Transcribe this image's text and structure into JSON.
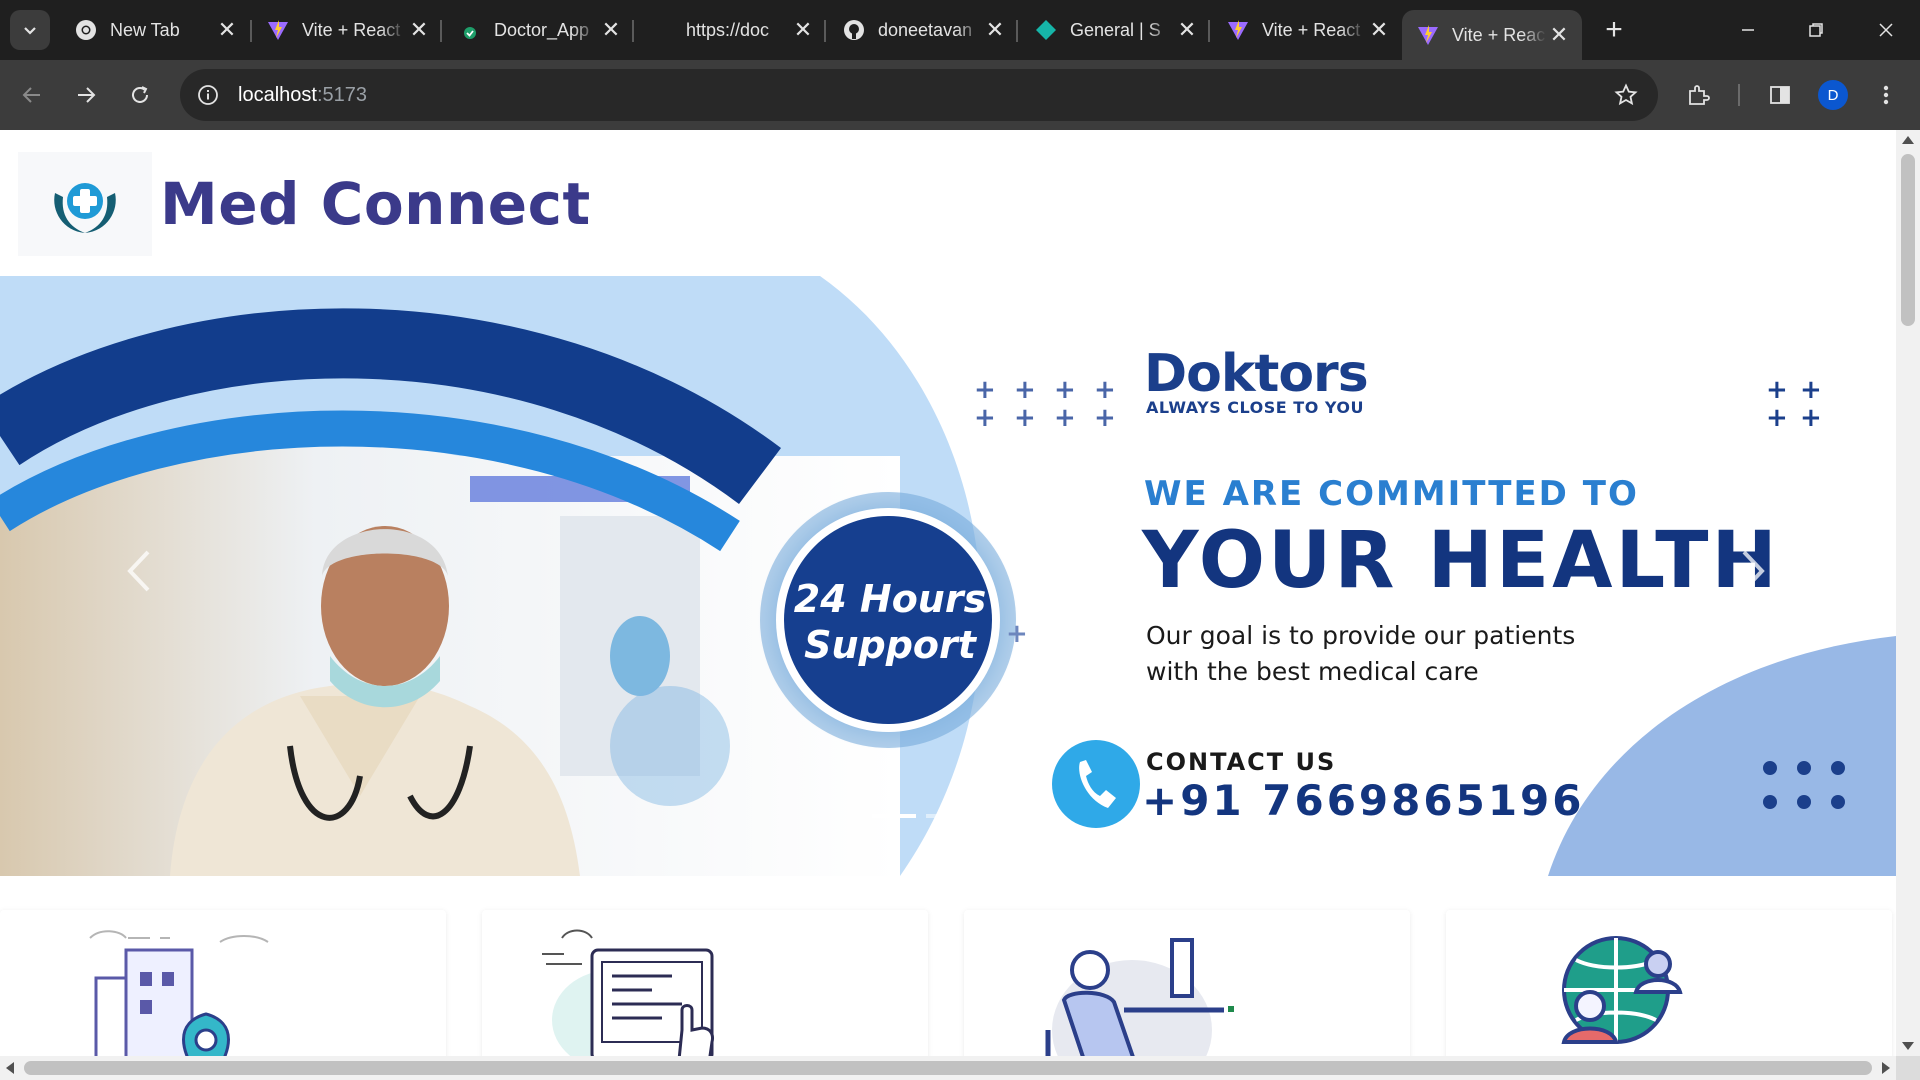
{
  "browser": {
    "tabs": [
      {
        "title": "New Tab",
        "icon": "chrome-icon"
      },
      {
        "title": "Vite + React",
        "icon": "vite-icon"
      },
      {
        "title": "Doctor_App",
        "icon": "check-badge-icon"
      },
      {
        "title": "https://doc",
        "icon": "blank-icon"
      },
      {
        "title": "doneetavan",
        "icon": "github-icon"
      },
      {
        "title": "General | S",
        "icon": "diamond-icon"
      },
      {
        "title": "Vite + React",
        "icon": "vite-icon"
      },
      {
        "title": "Vite + React",
        "icon": "vite-icon",
        "active": true
      }
    ],
    "url_host": "localhost",
    "url_port": ":5173",
    "profile_initial": "D"
  },
  "site": {
    "brand": "Med Connect",
    "colors": {
      "brand": "#3b3a8a",
      "hero_dark": "#13357f",
      "hero_accent": "#2a7fd0"
    }
  },
  "hero": {
    "brand_name": "Doktors",
    "brand_tagline": "ALWAYS CLOSE TO YOU",
    "headline_small": "WE ARE COMMITTED TO",
    "headline_big": "YOUR HEALTH",
    "goal_line1": "Our goal is to provide our patients",
    "goal_line2": "with the best medical care",
    "support_line1": "24 Hours",
    "support_line2": "Support",
    "contact_label": "CONTACT US",
    "contact_phone": "+91 7669865196",
    "slides_total": 3,
    "active_slide": 1
  },
  "features": [
    {
      "icon": "location-building-icon"
    },
    {
      "icon": "online-booking-icon"
    },
    {
      "icon": "consultant-desk-icon"
    },
    {
      "icon": "global-network-icon"
    }
  ]
}
